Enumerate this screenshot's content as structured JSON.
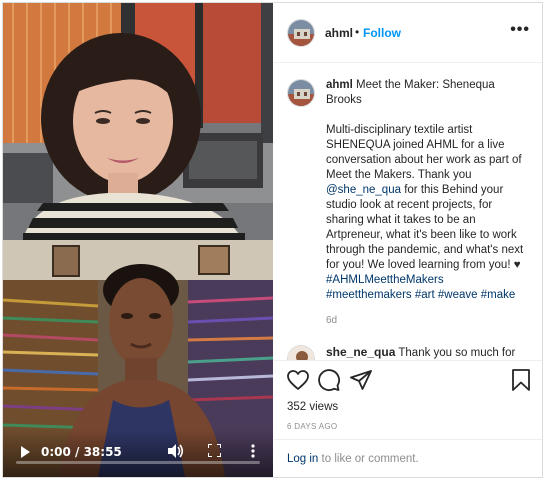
{
  "post": {
    "username": "ahml",
    "separator": "•",
    "follow_label": "Follow",
    "more_label": "•••"
  },
  "caption": {
    "username": "ahml",
    "title": "Meet the Maker: Shenequa Brooks",
    "body_before_mention": "Multi-disciplinary textile artist SHENEQUA joined AHML for a live conversation about her work as part of Meet the Makers. Thank you",
    "mention": "@she_ne_qua",
    "body_after_mention": "for this Behind your studio look at recent projects, for sharing what it takes to be an Artpreneur, what it's been like to work through the pandemic, and what's next for you! We loved learning from you! ♥",
    "hashtags": [
      "#AHMLMeettheMakers",
      "#meetthemakers",
      "#art",
      "#weave",
      "#make"
    ],
    "age": "6d"
  },
  "comment": {
    "username": "she_ne_qua",
    "text": "Thank you so much for"
  },
  "video": {
    "time_display": "0:00 / 38:55",
    "progress": 0
  },
  "stats": {
    "views": "352 views",
    "time_ago": "6 DAYS AGO"
  },
  "login": {
    "link_label": "Log in",
    "suffix": "to like or comment."
  },
  "icons": [
    "heart-icon",
    "comment-icon",
    "share-icon",
    "bookmark-icon",
    "play-icon",
    "volume-icon",
    "fullscreen-icon",
    "kebab-icon"
  ],
  "colors": {
    "link_blue": "#0095f6",
    "hashtag_blue": "#00376b",
    "muted_text": "#8e8e8e",
    "divider": "#efefef"
  }
}
